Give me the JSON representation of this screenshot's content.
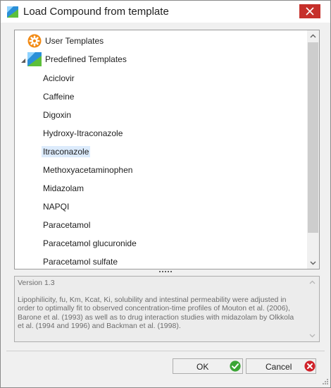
{
  "window": {
    "title": "Load Compound from template",
    "icon": "app-logo-icon",
    "close_icon": "close-icon"
  },
  "tree": {
    "nodes": [
      {
        "label": "User Templates",
        "icon": "gear-icon",
        "expanded": false
      },
      {
        "label": "Predefined Templates",
        "icon": "app-logo-icon",
        "expanded": true
      }
    ],
    "items": [
      {
        "label": "Aciclovir",
        "selected": false
      },
      {
        "label": "Caffeine",
        "selected": false
      },
      {
        "label": "Digoxin",
        "selected": false
      },
      {
        "label": "Hydroxy-Itraconazole",
        "selected": false
      },
      {
        "label": "Itraconazole",
        "selected": true
      },
      {
        "label": "Methoxyacetaminophen",
        "selected": false
      },
      {
        "label": "Midazolam",
        "selected": false
      },
      {
        "label": "NAPQI",
        "selected": false
      },
      {
        "label": "Paracetamol",
        "selected": false
      },
      {
        "label": "Paracetamol glucuronide",
        "selected": false
      },
      {
        "label": "Paracetamol sulfate",
        "selected": false
      }
    ]
  },
  "description": {
    "version": "Version 1.3",
    "body": "Lipophilicity, fu, Km, Kcat, Ki, solubility and intestinal permeability were adjusted in order to optimally fit to observed concentration-time profiles of Mouton et al. (2006), Barone et al. (1993) as well as to drug interaction studies with midazolam by Olkkola et al. (1994 and 1996) and Backman et al. (1998)."
  },
  "buttons": {
    "ok": {
      "label": "OK",
      "icon": "checkmark-icon"
    },
    "cancel": {
      "label": "Cancel",
      "icon": "cancel-icon"
    }
  },
  "colors": {
    "close_button": "#c6302b",
    "selection": "#dcebfc",
    "ok_icon": "#3aa535",
    "cancel_icon": "#d0222a",
    "gear_icon": "#f28a14"
  }
}
